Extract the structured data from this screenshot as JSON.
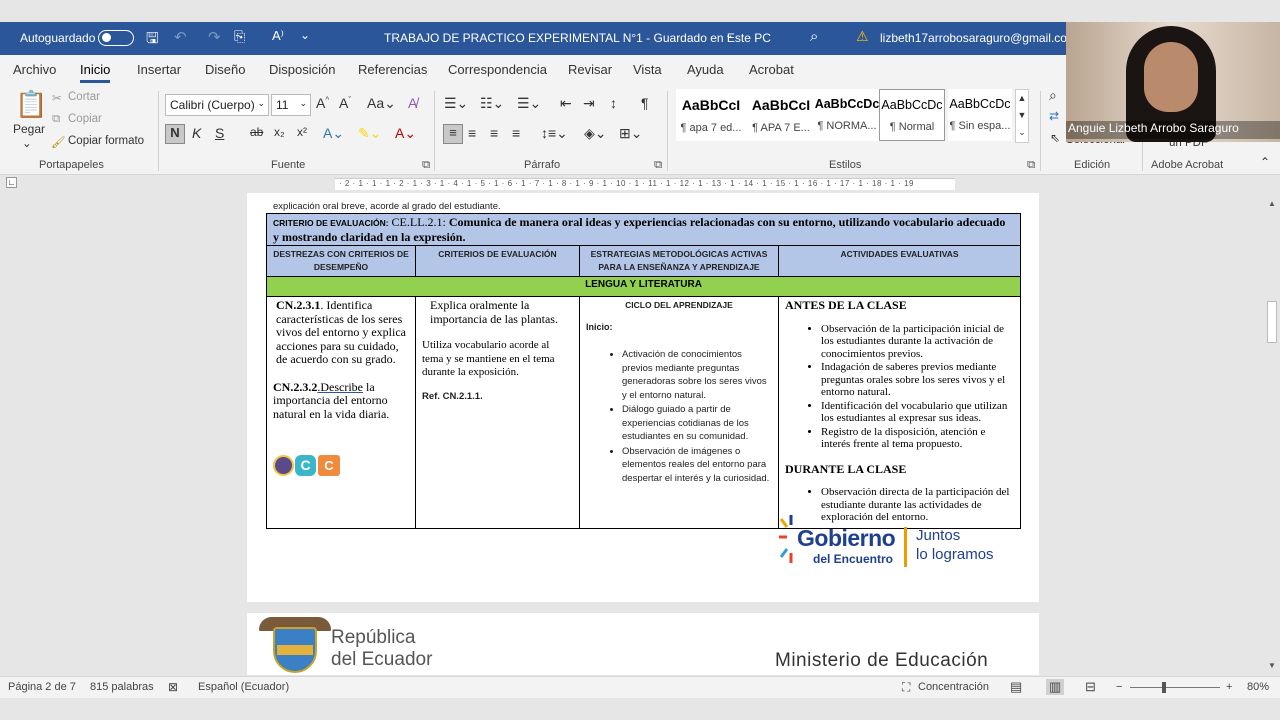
{
  "titlebar": {
    "autosave_label": "Autoguardado",
    "doc_title": "TRABAJO DE PRACTICO EXPERIMENTAL N°1  -  Guardado en Este PC",
    "account": "lizbeth17arrobosaraguro@gmail.com"
  },
  "menu": [
    "Archivo",
    "Inicio",
    "Insertar",
    "Diseño",
    "Disposición",
    "Referencias",
    "Correspondencia",
    "Revisar",
    "Vista",
    "Ayuda",
    "Acrobat"
  ],
  "ribbon": {
    "clipboard": {
      "paste": "Pegar",
      "cut": "Cortar",
      "copy": "Copiar",
      "format_painter": "Copiar formato",
      "label": "Portapapeles"
    },
    "font": {
      "name": "Calibri (Cuerpo)",
      "size": "11",
      "label": "Fuente",
      "bold": "N",
      "italic": "K",
      "underline": "S"
    },
    "paragraph": {
      "label": "Párrafo"
    },
    "styles": {
      "label": "Estilos",
      "items": [
        {
          "sample": "AaBbCcI",
          "name": "¶ apa 7 ed..."
        },
        {
          "sample": "AaBbCcI",
          "name": "¶ APA 7 E..."
        },
        {
          "sample": "AaBbCcDc",
          "name": "¶ NORMA..."
        },
        {
          "sample": "AaBbCcDc",
          "name": "¶ Normal"
        },
        {
          "sample": "AaBbCcDc",
          "name": "¶ Sin espa..."
        }
      ]
    },
    "editing": {
      "label": "Edición",
      "select": "Seleccionar"
    },
    "acrobat": {
      "label": "Adobe Acrobat",
      "pdf": "un PDF"
    }
  },
  "ruler": {
    "text": "· 2 · 1 · 1 · 1 · 2 · 1 · 3 · 1 · 4 · 1 · 5 · 1 · 6 · 1 · 7 · 1 · 8 · 1 · 9 · 1 · 10 · 1 · 11 · 1 · 12 · 1 · 13 · 1 · 14 · 1 · 15 · 1 · 16 · 1 · 17 · 1 · 18 · 1 · 19"
  },
  "document": {
    "top_line": "explicación oral breve, acorde al grado del estudiante.",
    "criterio_tag": "CRITERIO DE EVALUACIÓN:",
    "criterio_code": "CE.LL.2.1:",
    "criterio_text": "Comunica de manera oral ideas y experiencias relacionadas con su entorno, utilizando vocabulario adecuado y mostrando claridad en la expresión.",
    "headers": [
      "DESTREZAS CON CRITERIOS DE DESEMPEÑO",
      "CRITERIOS DE EVALUACIÓN",
      "ESTRATEGIAS METODOLÓGICAS ACTIVAS PARA LA ENSEÑANZA Y APRENDIZAJE",
      "ACTIVIDADES EVALUATIVAS"
    ],
    "area": "LENGUA Y LITERATURA",
    "col1": {
      "code1": "CN.2.3.1",
      "text1": ". Identifica características de los seres vivos del entorno y explica acciones para su cuidado, de acuerdo con su grado.",
      "code2": "CN.2.3.2",
      "link2": ".Describe",
      "text2": " la importancia del entorno natural en la vida diaria."
    },
    "col2": {
      "p1": "Explica oralmente la importancia de las plantas.",
      "p2": "Utiliza vocabulario acorde al tema y se mantiene en el tema durante la exposición.",
      "ref": "Ref. CN.2.1.1."
    },
    "col3": {
      "title": "CICLO DEL APRENDIZAJE",
      "inicio": "Inicio:",
      "items": [
        "Activación de conocimientos previos mediante preguntas generadoras sobre los seres vivos y el entorno natural.",
        "Diálogo guiado a partir de experiencias cotidianas de los estudiantes en su comunidad.",
        "Observación de imágenes o elementos reales del entorno para despertar el interés y la curiosidad."
      ]
    },
    "col4": {
      "before": "ANTES DE LA CLASE",
      "before_items": [
        "Observación de la participación inicial de los estudiantes durante la activación de conocimientos previos.",
        "Indagación de saberes previos mediante preguntas orales sobre los seres vivos y el entorno natural.",
        "Identificación del vocabulario que utilizan los estudiantes al expresar sus ideas.",
        "Registro de la disposición, atención e interés frente al tema propuesto."
      ],
      "during": "DURANTE LA CLASE",
      "during_items": [
        "Observación directa de la participación del estudiante durante las actividades de exploración del entorno."
      ]
    },
    "footer_logo": {
      "line1": "Gobierno",
      "line2": "del Encuentro",
      "slogan1": "Juntos",
      "slogan2": "lo logramos"
    },
    "page2": {
      "country1": "República",
      "country2": "del Ecuador",
      "ministry": "Ministerio de Educación"
    }
  },
  "statusbar": {
    "page": "Página 2 de 7",
    "words": "815 palabras",
    "language": "Español (Ecuador)",
    "focus": "Concentración",
    "zoom": "80%"
  },
  "webcam": {
    "name": "Anguie Lizbeth Arrobo Saraguro"
  }
}
